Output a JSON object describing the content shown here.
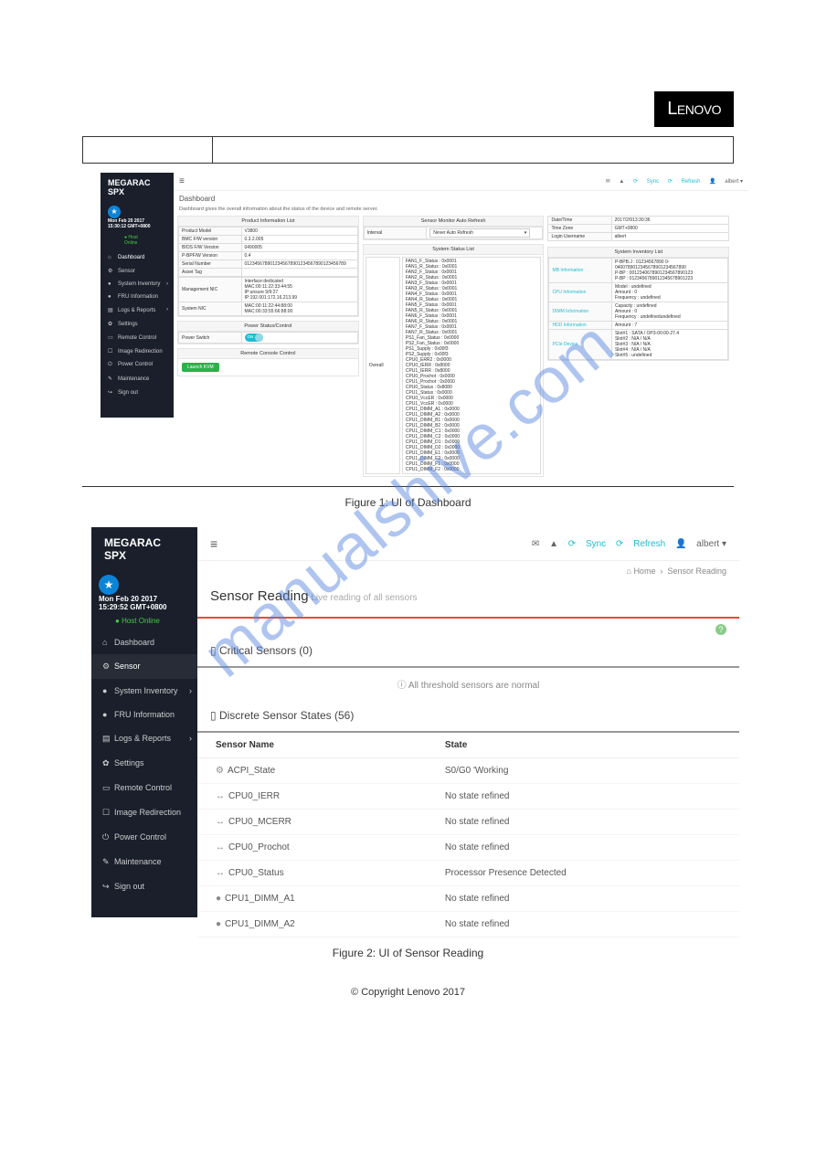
{
  "watermark": "manualshive.com",
  "brand_logo": "Lenovo",
  "sidebar_brand": "MEGARAC SPX",
  "sidebar": {
    "datetime_1": "Mon Feb 20 2017",
    "datetime_2_s1": "15:30:12 GMT+0800",
    "datetime_2_s2": "15:29:52 GMT+0800",
    "host_status": "Host Online",
    "items": [
      {
        "icon": "⌂",
        "label": "Dashboard",
        "name": "dashboard"
      },
      {
        "icon": "⚙",
        "label": "Sensor",
        "name": "sensor"
      },
      {
        "icon": "●",
        "label": "System Inventory",
        "name": "system-inventory",
        "chev": true
      },
      {
        "icon": "●",
        "label": "FRU Information",
        "name": "fru-information"
      },
      {
        "icon": "▤",
        "label": "Logs & Reports",
        "name": "logs-reports",
        "chev": true
      },
      {
        "icon": "✿",
        "label": "Settings",
        "name": "settings"
      },
      {
        "icon": "▭",
        "label": "Remote Control",
        "name": "remote-control"
      },
      {
        "icon": "☐",
        "label": "Image Redirection",
        "name": "image-redirection"
      },
      {
        "icon": "⏻",
        "label": "Power Control",
        "name": "power-control"
      },
      {
        "icon": "✎",
        "label": "Maintenance",
        "name": "maintenance"
      },
      {
        "icon": "↪",
        "label": "Sign out",
        "name": "sign-out"
      }
    ]
  },
  "topbar": {
    "mail": "✉",
    "warn": "▲",
    "sync": "Sync",
    "refresh": "Refresh",
    "user": "albert"
  },
  "dashboard": {
    "title": "Dashboard",
    "subtitle": "Dashboard gives the overall information about the status of the device and remote server.",
    "product_info_title": "Product Information List",
    "product_rows": [
      [
        "Product Model",
        "V3800"
      ],
      [
        "BMC F/W version",
        "0.3.2.005"
      ],
      [
        "BIOS F/W Version",
        "0490005"
      ],
      [
        "P-BPF/W Version",
        "0.4"
      ],
      [
        "Serial Number",
        "0123456789012345678901234567890123456789"
      ],
      [
        "Asset Tag",
        ""
      ]
    ],
    "mgmt_nic": {
      "label": "Management NIC",
      "lines": [
        "Interface:dedicated",
        "MAC:00:11:22:33:44:55",
        "IP:unsure 9/9:27",
        "IP:192.001:172.16.213.99"
      ]
    },
    "system_nic": {
      "label": "System NIC",
      "lines": [
        "MAC:00:11:22:44:88:00",
        "MAC:00:33:55:66:88:00"
      ]
    },
    "power_status_title": "Power Status/Control",
    "power_switch_label": "Power Switch",
    "power_switch_state": "ON",
    "remote_console_title": "Remote Console Control",
    "launch_button": "Launch KVM",
    "sensor_monitor_title": "Sensor Monitor Auto Refresh",
    "sensor_interval_label": "Interval",
    "sensor_interval_value": "Never Auto Refresh",
    "system_status_title": "System Status List",
    "status_overall": "Overall",
    "status_rows": [
      "FAN1_F_Status : 0x0001",
      "FAN1_R_Status : 0x0001",
      "FAN2_F_Status : 0x0001",
      "FAN2_R_Status : 0x0001",
      "FAN3_F_Status : 0x0001",
      "FAN3_R_Status : 0x0001",
      "FAN4_F_Status : 0x0001",
      "FAN4_R_Status : 0x0001",
      "FAN5_F_Status : 0x0001",
      "FAN5_R_Status : 0x0001",
      "FAN6_F_Status : 0x0001",
      "FAN6_R_Status : 0x0001",
      "FAN7_F_Status : 0x0001",
      "FAN7_R_Status : 0x0001",
      "PS1_Fan_Status : 0x0000",
      "PS2_Fan_Status : 0x0000",
      "PS1_Supply : 0x00f3",
      "PS2_Supply : 0x00f3",
      "CPU0_ERR2 : 0x0000",
      "CPU0_IERR : 0x8000",
      "CPU1_IERR : 0x8000",
      "CPU0_Prochot : 0x0000",
      "CPU1_Prochot : 0x0000",
      "CPU0_Status : 0x8080",
      "CPU1_Status : 0x0000",
      "CPU0_VccER : 0x0000",
      "CPU1_VccER : 0x0000",
      "CPU1_DIMM_A1 : 0x0000",
      "CPU1_DIMM_A2 : 0x0000",
      "CPU1_DIMM_B1 : 0x0000",
      "CPU1_DIMM_B2 : 0x0000",
      "CPU1_DIMM_C1 : 0x0000",
      "CPU1_DIMM_C2 : 0x0000",
      "CPU1_DIMM_D1 : 0x0000",
      "CPU1_DIMM_D2 : 0x0000",
      "CPU1_DIMM_E1 : 0x0000",
      "CPU1_DIMM_E2 : 0x0000",
      "CPU1_DIMM_F1 : 0x0000",
      "CPU1_DIMM_F2 : 0x0000"
    ],
    "top_right_rows": [
      [
        "Date/Time",
        "2017/2/913:30:36"
      ],
      [
        "Time Zone",
        "GMT+0800"
      ],
      [
        "Login Username",
        "albert"
      ]
    ],
    "sys_inv_title": "System Inventory List",
    "sys_inv_rows": [
      {
        "k": "MB Information",
        "k_color": "#1fbdd2",
        "v": [
          "P-BPB.J : 01234567890 0-0400789012345678901234567890",
          "P-BP : 0012340678901234567890123",
          "P-BP : 0123456789012345678901223"
        ]
      },
      {
        "k": "CPU Information",
        "k_color": "#1fbdd2",
        "v": [
          "Model : undefined",
          "Amount : 0",
          "Frequency : undefined"
        ]
      },
      {
        "k": "DIMM Information",
        "k_color": "#1fbdd2",
        "v": [
          "Capacity : undefined",
          "Amount : 0",
          "Frequency : undefinedundefined"
        ]
      },
      {
        "k": "HDD Information",
        "k_color": "#1fbdd2",
        "v": [
          "Amount : 7"
        ]
      },
      {
        "k": "PCIe Device",
        "k_color": "#1fbdd2",
        "v": [
          "Slot#1 : SATA / OP3-00:00-27.4",
          "Slot#2 : N/A / N/A",
          "Slot#3 : N/A / N/A",
          "Slot#4 : N/A / N/A",
          "Slot#5 : undefined"
        ]
      }
    ]
  },
  "caption1": "Figure 1: UI of Dashboard",
  "sensor": {
    "title": "Sensor Reading",
    "subtitle": "Live reading of all sensors",
    "breadcrumb_home": "Home",
    "breadcrumb_page": "Sensor Reading",
    "critical_title": "Critical Sensors (0)",
    "normal_msg": "All threshold sensors are normal",
    "discrete_title": "Discrete Sensor States (56)",
    "col_name": "Sensor Name",
    "col_state": "State",
    "rows": [
      {
        "icon": "⚙",
        "name": "ACPI_State",
        "state": "S0/G0 'Working"
      },
      {
        "icon": "↔",
        "name": "CPU0_IERR",
        "state": "No state refined"
      },
      {
        "icon": "↔",
        "name": "CPU0_MCERR",
        "state": "No state refined"
      },
      {
        "icon": "↔",
        "name": "CPU0_Prochot",
        "state": "No state refined"
      },
      {
        "icon": "↔",
        "name": "CPU0_Status",
        "state": "Processor Presence Detected"
      },
      {
        "icon": "●",
        "name": "CPU1_DIMM_A1",
        "state": "No state refined"
      },
      {
        "icon": "●",
        "name": "CPU1_DIMM_A2",
        "state": "No state refined"
      }
    ]
  },
  "caption2": "Figure 2: UI of Sensor Reading",
  "footer": "© Copyright Lenovo 2017"
}
